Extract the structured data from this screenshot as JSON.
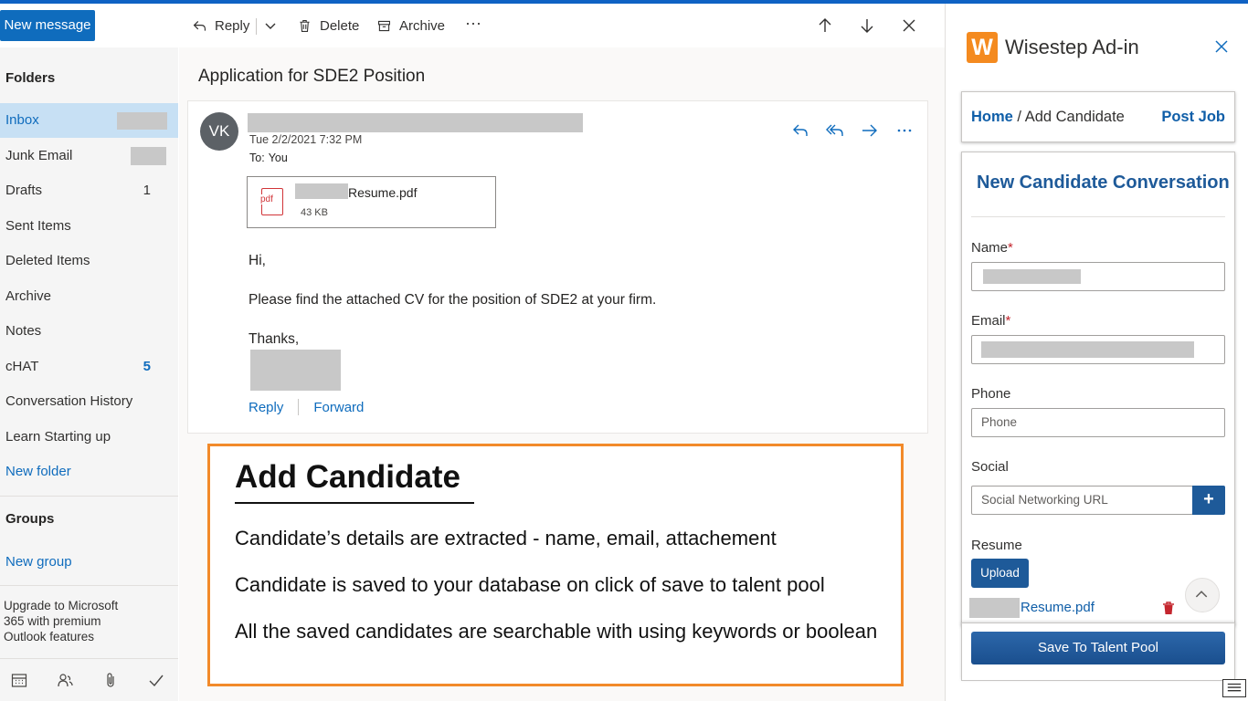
{
  "toolbar": {
    "new_message": "New message",
    "reply": "Reply",
    "delete": "Delete",
    "archive": "Archive",
    "more": "···"
  },
  "nav": {
    "folders_heading": "Folders",
    "items": [
      {
        "label": "Inbox",
        "count": ""
      },
      {
        "label": "Junk Email",
        "count": ""
      },
      {
        "label": "Drafts",
        "count": "1"
      },
      {
        "label": "Sent Items",
        "count": ""
      },
      {
        "label": "Deleted Items",
        "count": ""
      },
      {
        "label": "Archive",
        "count": ""
      },
      {
        "label": "Notes",
        "count": ""
      },
      {
        "label": "cHAT",
        "count": "5"
      },
      {
        "label": "Conversation History",
        "count": ""
      },
      {
        "label": "Learn Starting up",
        "count": ""
      }
    ],
    "new_folder": "New folder",
    "groups_heading": "Groups",
    "new_group": "New group",
    "upgrade_text": "Upgrade to Microsoft 365 with premium Outlook features"
  },
  "message": {
    "subject": "Application for SDE2 Position",
    "avatar_initials": "VK",
    "date": "Tue 2/2/2021 7:32 PM",
    "to_label": "To:",
    "to_value": "You",
    "attachment": {
      "name": "Resume.pdf",
      "size": "43 KB",
      "icon_label": "pdf"
    },
    "greeting": "Hi,",
    "body": "Please find the attached CV for the position of SDE2 at your firm.",
    "closing": "Thanks,",
    "reply_link": "Reply",
    "forward_link": "Forward"
  },
  "annotation": {
    "title": "Add Candidate",
    "lines": [
      "Candidate’s details are extracted - name, email, attachement",
      "Candidate is saved to your database on click of save to talent pool",
      "All the saved candidates are searchable with using keywords or boolean"
    ],
    "border_color": "#f28a2a"
  },
  "addin": {
    "logo_letter": "W",
    "title": "Wisestep Ad-in",
    "breadcrumb_home": "Home",
    "breadcrumb_sep": " / ",
    "breadcrumb_current": "Add Candidate",
    "post_job": "Post Job",
    "form_title": "New Candidate Conversation",
    "name_label": "Name",
    "email_label": "Email",
    "required_mark": "*",
    "phone_label": "Phone",
    "phone_placeholder": "Phone",
    "social_label": "Social",
    "social_placeholder": "Social Networking URL",
    "add_symbol": "+",
    "resume_label": "Resume",
    "upload_button": "Upload",
    "resume_file": "Resume.pdf",
    "save_button": "Save To Talent Pool",
    "accent_color": "#1e5a99"
  }
}
